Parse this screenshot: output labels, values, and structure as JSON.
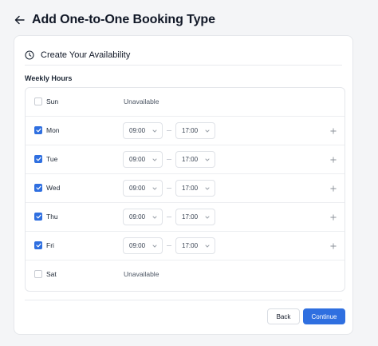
{
  "header": {
    "title": "Add One-to-One Booking Type",
    "back_icon": "arrow-left-icon"
  },
  "card": {
    "title": "Create Your Availability",
    "title_icon": "clock-icon",
    "section_label": "Weekly Hours"
  },
  "days": [
    {
      "name": "Sun",
      "checked": false,
      "status": "Unavailable"
    },
    {
      "name": "Mon",
      "checked": true,
      "start": "09:00",
      "end": "17:00"
    },
    {
      "name": "Tue",
      "checked": true,
      "start": "09:00",
      "end": "17:00"
    },
    {
      "name": "Wed",
      "checked": true,
      "start": "09:00",
      "end": "17:00"
    },
    {
      "name": "Thu",
      "checked": true,
      "start": "09:00",
      "end": "17:00"
    },
    {
      "name": "Fri",
      "checked": true,
      "start": "09:00",
      "end": "17:00"
    },
    {
      "name": "Sat",
      "checked": false,
      "status": "Unavailable"
    }
  ],
  "footer": {
    "back_label": "Back",
    "continue_label": "Continue"
  },
  "colors": {
    "accent": "#2f6fe0",
    "background": "#f4f5f7"
  }
}
